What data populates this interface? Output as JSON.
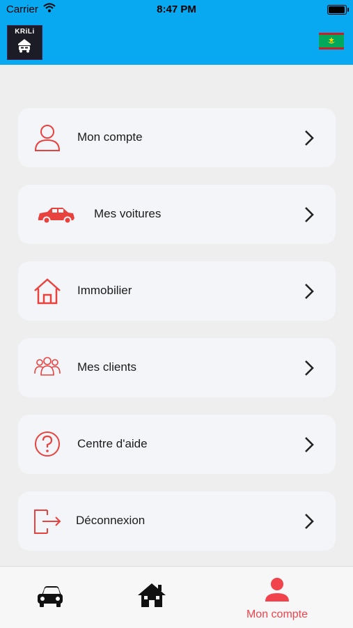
{
  "status_bar": {
    "carrier": "Carrier",
    "time": "8:47 PM"
  },
  "header": {
    "logo_text": "KRiLi",
    "flag": "mauritania-flag"
  },
  "menu": {
    "items": [
      {
        "label": "Mon compte",
        "icon": "user-icon"
      },
      {
        "label": "Mes voitures",
        "icon": "car-icon"
      },
      {
        "label": "Immobilier",
        "icon": "house-icon"
      },
      {
        "label": "Mes clients",
        "icon": "group-icon"
      },
      {
        "label": "Centre d'aide",
        "icon": "help-icon"
      },
      {
        "label": "Déconnexion",
        "icon": "logout-icon"
      }
    ]
  },
  "tab_bar": {
    "tabs": [
      {
        "icon": "car-icon",
        "label": ""
      },
      {
        "icon": "home-icon",
        "label": ""
      },
      {
        "icon": "user-icon",
        "label": "Mon compte",
        "active": true
      }
    ]
  },
  "colors": {
    "header": "#08a9f0",
    "accent": "#f0434b",
    "background": "#eeeeee",
    "card": "#f4f5f8"
  }
}
